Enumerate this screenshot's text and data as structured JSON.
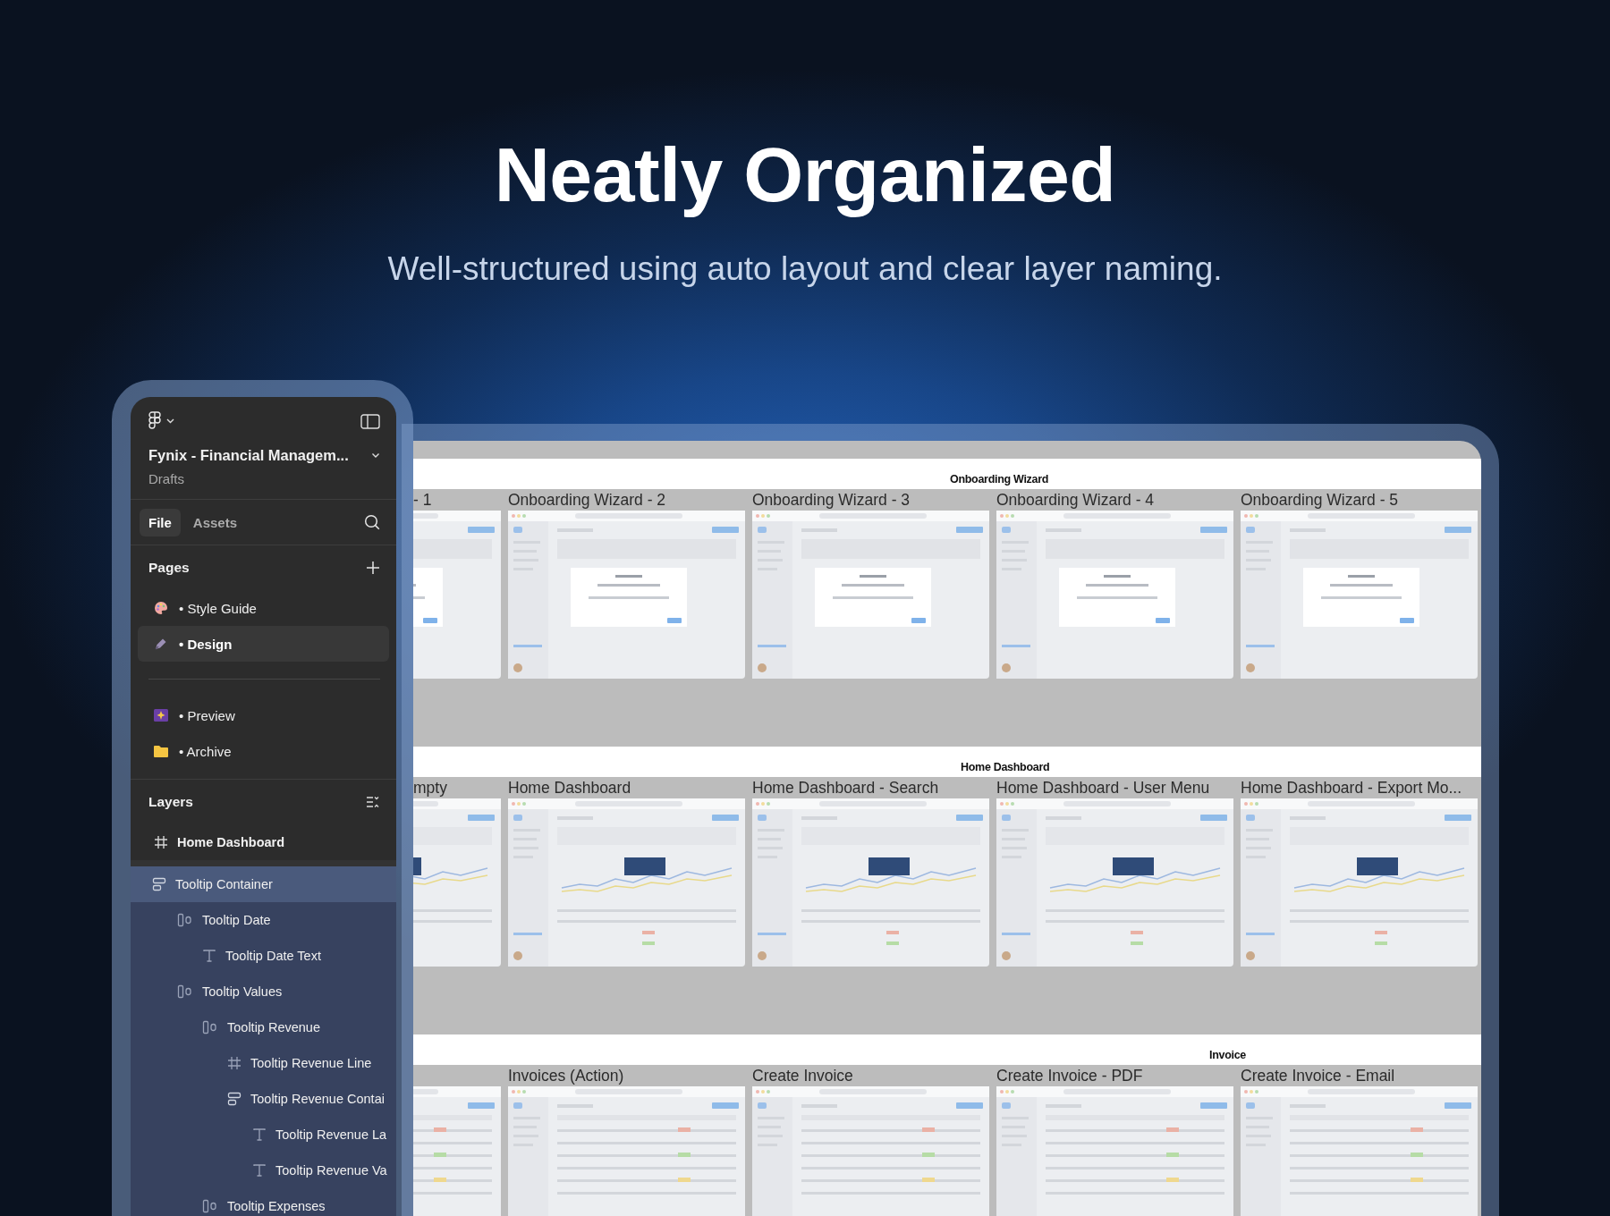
{
  "headline": "Neatly Organized",
  "subheadline": "Well-structured using auto layout and clear layer naming.",
  "sidebar": {
    "file_name": "Fynix - Financial Managem...",
    "location": "Drafts",
    "tabs": [
      {
        "label": "File",
        "selected": true
      },
      {
        "label": "Assets",
        "selected": false
      }
    ],
    "pages_title": "Pages",
    "pages": [
      {
        "kind": "page",
        "label": "• Style Guide",
        "selected": false
      },
      {
        "kind": "page",
        "label": "• Design",
        "selected": true
      },
      {
        "kind": "divider"
      },
      {
        "kind": "page",
        "label": "• Preview",
        "selected": false
      },
      {
        "kind": "page",
        "label": "• Archive",
        "selected": false
      }
    ],
    "layers_title": "Layers",
    "layers_header": {
      "label": "Home Dashboard",
      "kind": "frame"
    },
    "layers": [
      {
        "label": "Tooltip Container",
        "kind": "stack",
        "selected": true,
        "children": [
          {
            "label": "Tooltip Date",
            "kind": "row",
            "selected": false,
            "children": [
              {
                "label": "Tooltip Date Text",
                "kind": "text",
                "selected": false
              }
            ]
          },
          {
            "label": "Tooltip Values",
            "kind": "row",
            "selected": false,
            "children": [
              {
                "label": "Tooltip Revenue",
                "kind": "row",
                "selected": false,
                "children": [
                  {
                    "label": "Tooltip Revenue Line",
                    "kind": "frame",
                    "selected": false
                  },
                  {
                    "label": "Tooltip Revenue Contai",
                    "kind": "stack",
                    "selected": false,
                    "children": [
                      {
                        "label": "Tooltip Revenue La",
                        "kind": "text",
                        "selected": false
                      },
                      {
                        "label": "Tooltip Revenue Va",
                        "kind": "text",
                        "selected": false
                      }
                    ]
                  }
                ]
              },
              {
                "label": "Tooltip Expenses",
                "kind": "row",
                "selected": false
              }
            ]
          }
        ]
      }
    ]
  },
  "canvas": {
    "sections": [
      {
        "name": "Onboarding Wizard",
        "frames": [
          {
            "kind": "screen",
            "title": "- 1"
          },
          {
            "kind": "screen",
            "title": "Onboarding Wizard - 2"
          },
          {
            "kind": "screen",
            "title": "Onboarding Wizard - 3"
          },
          {
            "kind": "screen",
            "title": "Onboarding Wizard - 4"
          },
          {
            "kind": "screen",
            "title": "Onboarding Wizard - 5"
          }
        ]
      },
      {
        "name": "Home Dashboard",
        "frames": [
          {
            "kind": "screen",
            "title": "mpty"
          },
          {
            "kind": "screen",
            "title": "Home Dashboard"
          },
          {
            "kind": "screen",
            "title": "Home Dashboard - Search"
          },
          {
            "kind": "screen",
            "title": "Home Dashboard - User Menu"
          },
          {
            "kind": "screen",
            "title": "Home Dashboard - Export Mo..."
          }
        ]
      },
      {
        "name": "Invoice",
        "frames": [
          {
            "kind": "screen"
          },
          {
            "kind": "screen",
            "title": "Invoices (Action)"
          },
          {
            "kind": "screen",
            "title": "Create Invoice"
          },
          {
            "kind": "screen",
            "title": "Create Invoice - PDF"
          },
          {
            "kind": "screen",
            "title": "Create Invoice - Email"
          }
        ]
      }
    ]
  }
}
